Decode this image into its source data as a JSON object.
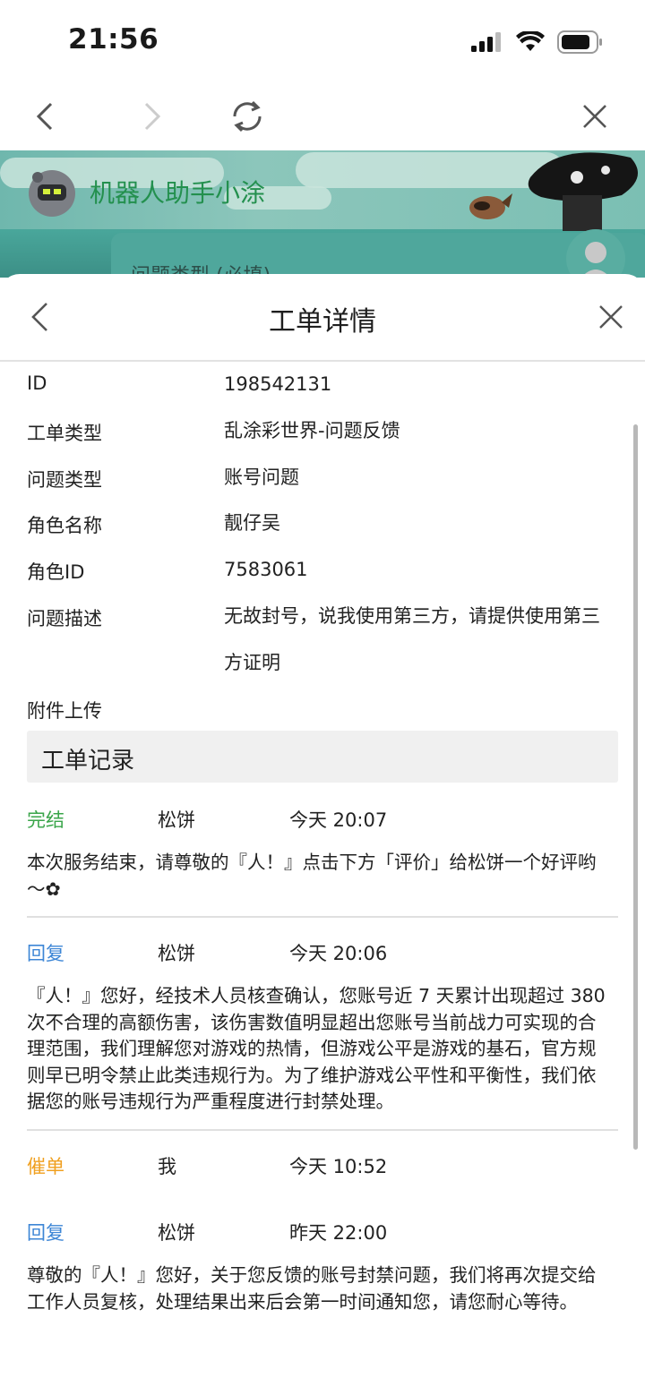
{
  "status_bar": {
    "time": "21:56"
  },
  "banner": {
    "title": "机器人助手小涂",
    "field_label": "问题类型 (必填)"
  },
  "sheet": {
    "title": "工单详情",
    "fields": [
      {
        "label": "ID",
        "value": "198542131"
      },
      {
        "label": "工单类型",
        "value": "乱涂彩世界-问题反馈"
      },
      {
        "label": "问题类型",
        "value": "账号问题"
      },
      {
        "label": "角色名称",
        "value": "靓仔吴"
      },
      {
        "label": "角色ID",
        "value": "7583061"
      },
      {
        "label": "问题描述",
        "value": "无故封号，说我使用第三方，请提供使用第三方证明"
      },
      {
        "label": "附件上传",
        "value": ""
      }
    ],
    "records_title": "工单记录",
    "records": [
      {
        "status": "完结",
        "status_color": "#3aa54a",
        "author": "松饼",
        "time": "今天 20:07",
        "body": "本次服务结束，请尊敬的『人！』点击下方「评价」给松饼一个好评哟～✿"
      },
      {
        "status": "回复",
        "status_color": "#3d86d6",
        "author": "松饼",
        "time": "今天 20:06",
        "body": "『人！』您好，经技术人员核查确认，您账号近 7 天累计出现超过 380 次不合理的高额伤害，该伤害数值明显超出您账号当前战力可实现的合理范围，我们理解您对游戏的热情，但游戏公平是游戏的基石，官方规则早已明令禁止此类违规行为。为了维护游戏公平性和平衡性，我们依据您的账号违规行为严重程度进行封禁处理。"
      },
      {
        "status": "催单",
        "status_color": "#f0a020",
        "author": "我",
        "time": "今天 10:52",
        "body": ""
      },
      {
        "status": "回复",
        "status_color": "#3d86d6",
        "author": "松饼",
        "time": "昨天 22:00",
        "body": "尊敬的『人！』您好，关于您反馈的账号封禁问题，我们将再次提交给工作人员复核，处理结果出来后会第一时间通知您，请您耐心等待。"
      }
    ]
  }
}
